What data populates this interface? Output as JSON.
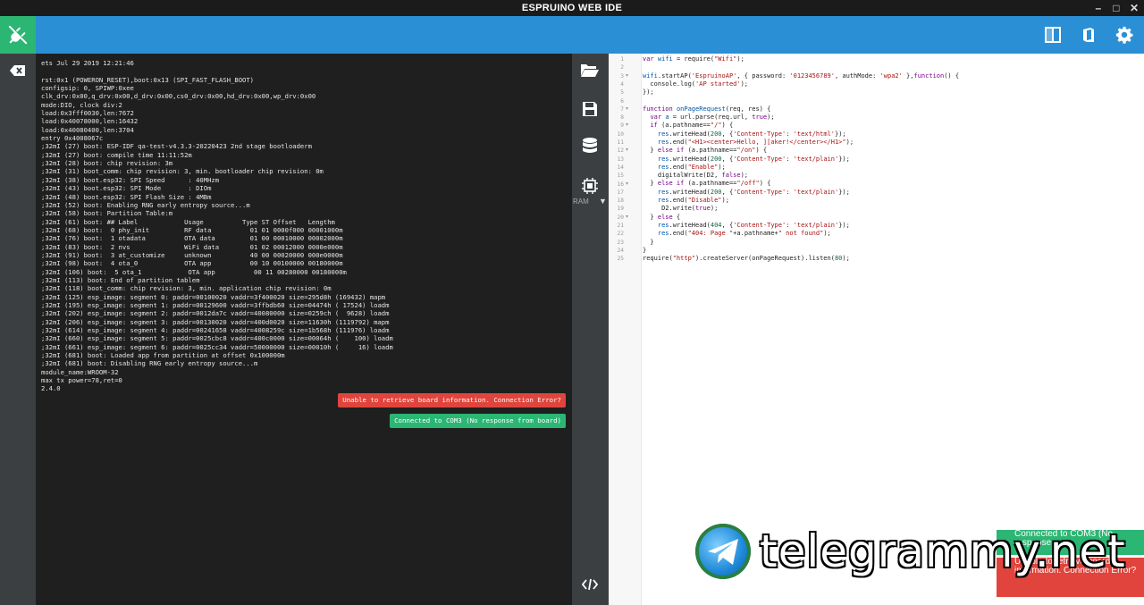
{
  "app": {
    "title": "ESPRUINO WEB IDE"
  },
  "window_controls": [
    "minimize",
    "maximize",
    "close"
  ],
  "toolbar": {
    "connect_icon": "plug-icon",
    "right_icons": [
      "split-view-icon",
      "book-icon",
      "gear-icon"
    ]
  },
  "colors": {
    "toolbar": "#2b8fd5",
    "connect": "#2bb673",
    "error": "#e0443c",
    "success": "#2bb673"
  },
  "console": {
    "lines": [
      "ets Jul 29 2019 12:21:46",
      "",
      "rst:0x1 (POWERON_RESET),boot:0x13 (SPI_FAST_FLASH_BOOT)",
      "configsip: 0, SPIWP:0xee",
      "clk_drv:0x00,q_drv:0x00,d_drv:0x00,cs0_drv:0x00,hd_drv:0x00,wp_drv:0x00",
      "mode:DIO, clock div:2",
      "load:0x3fff0030,len:7672",
      "load:0x40078000,len:16432",
      "load:0x40080400,len:3704",
      "entry 0x4008067c",
      ";32mI (27) boot: ESP-IDF qa-test-v4.3.3-20220423 2nd stage bootloaderm",
      ";32mI (27) boot: compile time 11:11:52m",
      ";32mI (28) boot: chip revision: 3m",
      ";32mI (31) boot_comm: chip revision: 3, min. bootloader chip revision: 0m",
      ";32mI (38) boot.esp32: SPI Speed      : 40MHzm",
      ";32mI (43) boot.esp32: SPI Mode       : DIOm",
      ";32mI (48) boot.esp32: SPI Flash Size : 4MBm",
      ";32mI (52) boot: Enabling RNG early entropy source...m",
      ";32mI (58) boot: Partition Table:m",
      ";32mI (61) boot: ## Label            Usage          Type ST Offset   Lengthm",
      ";32mI (68) boot:  0 phy_init         RF data          01 01 0000f000 00001000m",
      ";32mI (76) boot:  1 otadata          OTA data         01 00 00010000 00002000m",
      ";32mI (83) boot:  2 nvs              WiFi data        01 02 00012000 0000e000m",
      ";32mI (91) boot:  3 at_customize     unknown          40 00 00020000 000e0000m",
      ";32mI (98) boot:  4 ota_0            OTA app          00 10 00100000 00180000m",
      ";32mI (106) boot:  5 ota_1            OTA app          00 11 00280000 00180000m",
      ";32mI (113) boot: End of partition tablem",
      ";32mI (118) boot_comm: chip revision: 3, min. application chip revision: 0m",
      ";32mI (125) esp_image: segment 0: paddr=00100020 vaddr=3f400020 size=295d8h (169432) mapm",
      ";32mI (195) esp_image: segment 1: paddr=00129600 vaddr=3ffbdb60 size=04474h ( 17524) loadm",
      ";32mI (202) esp_image: segment 2: paddr=0012da7c vaddr=40080000 size=0259ch (  9628) loadm",
      ";32mI (206) esp_image: segment 3: paddr=00130020 vaddr=400d0020 size=11630h (1119792) mapm",
      ";32mI (614) esp_image: segment 4: paddr=00241658 vaddr=4008259c size=1b568h (111976) loadm",
      ";32mI (660) esp_image: segment 5: paddr=0025cbc8 vaddr=400c0000 size=00064h (    100) loadm",
      ";32mI (661) esp_image: segment 6: paddr=0025cc34 vaddr=50000000 size=00010h (     16) loadm",
      ";32mI (681) boot: Loaded app from partition at offset 0x100000m",
      ";32mI (681) boot: Disabling RNG early entropy source...m",
      "module_name:WROOM-32",
      "max tx power=78,ret=0",
      "2.4.0"
    ],
    "toast_error": "Unable to retrieve board information. Connection Error?",
    "toast_success": "Connected to COM3 (No response from board)"
  },
  "mid_rail": {
    "icons": [
      "folder-open-icon",
      "save-icon",
      "database-icon",
      "chip-icon",
      "code-icon"
    ],
    "ram_label": "RAM",
    "ram_arrow": "▼"
  },
  "editor": {
    "line_numbers": [
      "1",
      "2",
      "3",
      "4",
      "5",
      "6",
      "7",
      "8",
      "9",
      "10",
      "11",
      "12",
      "13",
      "14",
      "15",
      "16",
      "17",
      "18",
      "19",
      "20",
      "21",
      "22",
      "23",
      "24",
      "25"
    ],
    "fold_lines": [
      "3",
      "7",
      "9",
      "12",
      "16",
      "20"
    ]
  },
  "overlays": {
    "green_badge": "Connected to COM3 (No response",
    "red_badge": "Unable to retrieve board information. Connection Error?"
  },
  "watermark": {
    "text": "telegrammy.net",
    "logo_icon": "telegram-logo-icon"
  }
}
